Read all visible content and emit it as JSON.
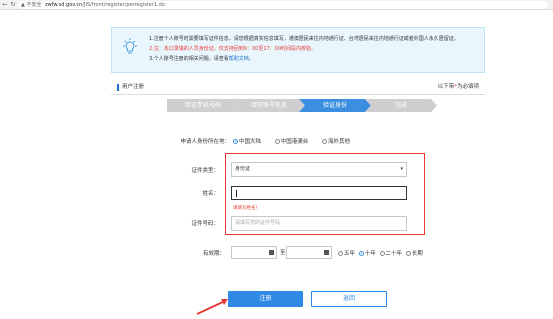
{
  "browser": {
    "warning": "不安全",
    "host": "zwfw.sd.gov.cn",
    "path": "/JIS/front/register/perregister1.do"
  },
  "notice": {
    "line1": "1.注册个人账号时需要填写证件信息，请您根据真实信息填写，港澳居民来往内地通行证、台湾居民来往内地通行证或者外国人永久居留证。",
    "line2": "2.注：本口录填的人员身份证，仅支持回到9：00至17：00时间段内校验。",
    "line3_prefix": "3.个人账号注册的相关问题，请查看",
    "line3_link": "帮助文档。"
  },
  "section": {
    "title": "用户注册",
    "required_prefix": "以下带",
    "required_star": "*",
    "required_suffix": "为必填项"
  },
  "steps": [
    {
      "label": "验证手机号码",
      "active": false
    },
    {
      "label": "填写账号信息",
      "active": false
    },
    {
      "label": "验证身份",
      "active": true
    },
    {
      "label": "完成",
      "active": false
    }
  ],
  "form": {
    "region_label": "申请人身份所在地：",
    "region_options": [
      {
        "label": "中国大陆",
        "checked": true
      },
      {
        "label": "中国港澳台",
        "checked": false
      },
      {
        "label": "海外其他",
        "checked": false
      }
    ],
    "id_type_label": "证件类型：",
    "id_type_value": "身份证",
    "name_label": "姓名：",
    "name_value": "",
    "name_error": "请填写姓名！",
    "id_number_label": "证件号码：",
    "id_number_placeholder": "请填写您的证件号码",
    "validity_label": "有效期：",
    "date_separator": "至",
    "validity_options": [
      {
        "label": "五年",
        "checked": false
      },
      {
        "label": "十年",
        "checked": true
      },
      {
        "label": "二十年",
        "checked": false
      },
      {
        "label": "长期",
        "checked": false
      }
    ]
  },
  "buttons": {
    "register": "注册",
    "back": "返回"
  },
  "colors": {
    "accent": "#2f8ae5",
    "step_active": "#3c8fe0",
    "step_inactive": "#cfcfcf",
    "highlight_box": "#e53935",
    "error_text": "#e53935",
    "notice_bg": "#eaf6fd"
  },
  "icons": [
    "back-icon",
    "forward-icon",
    "reload-icon",
    "warning-icon",
    "lightbulb-icon",
    "calendar-icon",
    "annotation-arrow"
  ]
}
